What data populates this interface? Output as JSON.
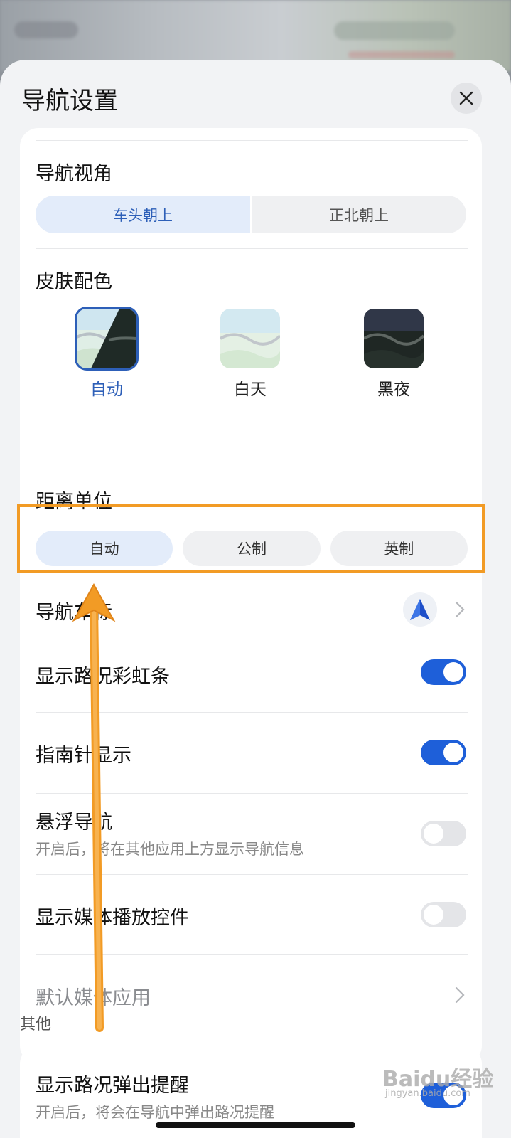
{
  "sheet": {
    "title": "导航设置"
  },
  "view_angle": {
    "label": "导航视角",
    "options": [
      "车头朝上",
      "正北朝上"
    ],
    "selected": "车头朝上"
  },
  "skin_color": {
    "label": "皮肤配色",
    "options": [
      "自动",
      "白天",
      "黑夜"
    ],
    "selected": "自动"
  },
  "distance_unit": {
    "label": "距离单位",
    "options": [
      "自动",
      "公制",
      "英制"
    ],
    "selected": "自动"
  },
  "car_icon": {
    "label": "导航车标",
    "icon": "blue-arrow-icon"
  },
  "rows": [
    {
      "label": "显示路况彩虹条",
      "toggle": true
    },
    {
      "label": "指南针显示",
      "toggle": true
    },
    {
      "label": "悬浮导航",
      "sub": "开启后，将在其他应用上方显示导航信息",
      "toggle": false
    },
    {
      "label": "显示媒体播放控件",
      "toggle": false
    },
    {
      "label": "默认媒体应用"
    }
  ],
  "other": {
    "label": "其他",
    "row": {
      "label": "显示路况弹出提醒",
      "sub": "开启后，将会在导航中弹出路况提醒"
    }
  },
  "watermark": {
    "text": "Baidu经验",
    "sub": "jingyan.baidu.com"
  },
  "colors": {
    "accent": "#1e5fd9",
    "highlight": "#f29b25",
    "active_text": "#2d5fb8"
  }
}
